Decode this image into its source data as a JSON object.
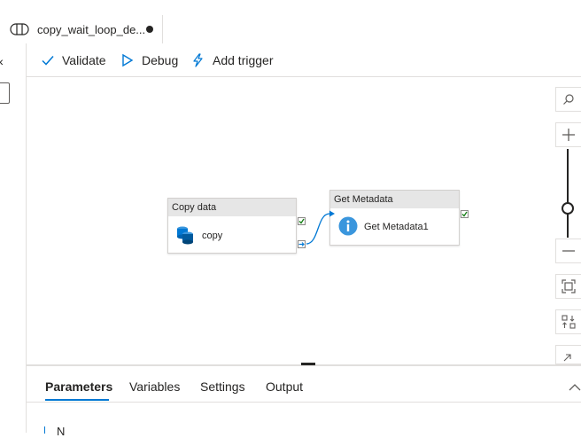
{
  "tab": {
    "title": "copy_wait_loop_de...",
    "icon": "pipeline-icon",
    "dirty_indicator": "unsaved-dot"
  },
  "toolbar": {
    "validate_label": "Validate",
    "debug_label": "Debug",
    "add_trigger_label": "Add trigger"
  },
  "left": {
    "collapse_glyph": "«"
  },
  "canvas": {
    "activities": [
      {
        "type_label": "Copy data",
        "name": "copy",
        "icon": "copy-data-icon"
      },
      {
        "type_label": "Get Metadata",
        "name": "Get Metadata1",
        "icon": "info-icon"
      }
    ]
  },
  "zoom_controls": [
    "search-icon",
    "zoom-in-icon",
    "zoom-slider",
    "zoom-out-icon",
    "fit-to-screen-icon",
    "auto-align-icon",
    "collapse-icon"
  ],
  "panel": {
    "tabs": [
      "Parameters",
      "Variables",
      "Settings",
      "Output"
    ],
    "active_tab": "Parameters",
    "new_label": "N"
  },
  "colors": {
    "accent": "#0078d4",
    "success": "#107c10",
    "header_gray": "#e6e6e6"
  }
}
